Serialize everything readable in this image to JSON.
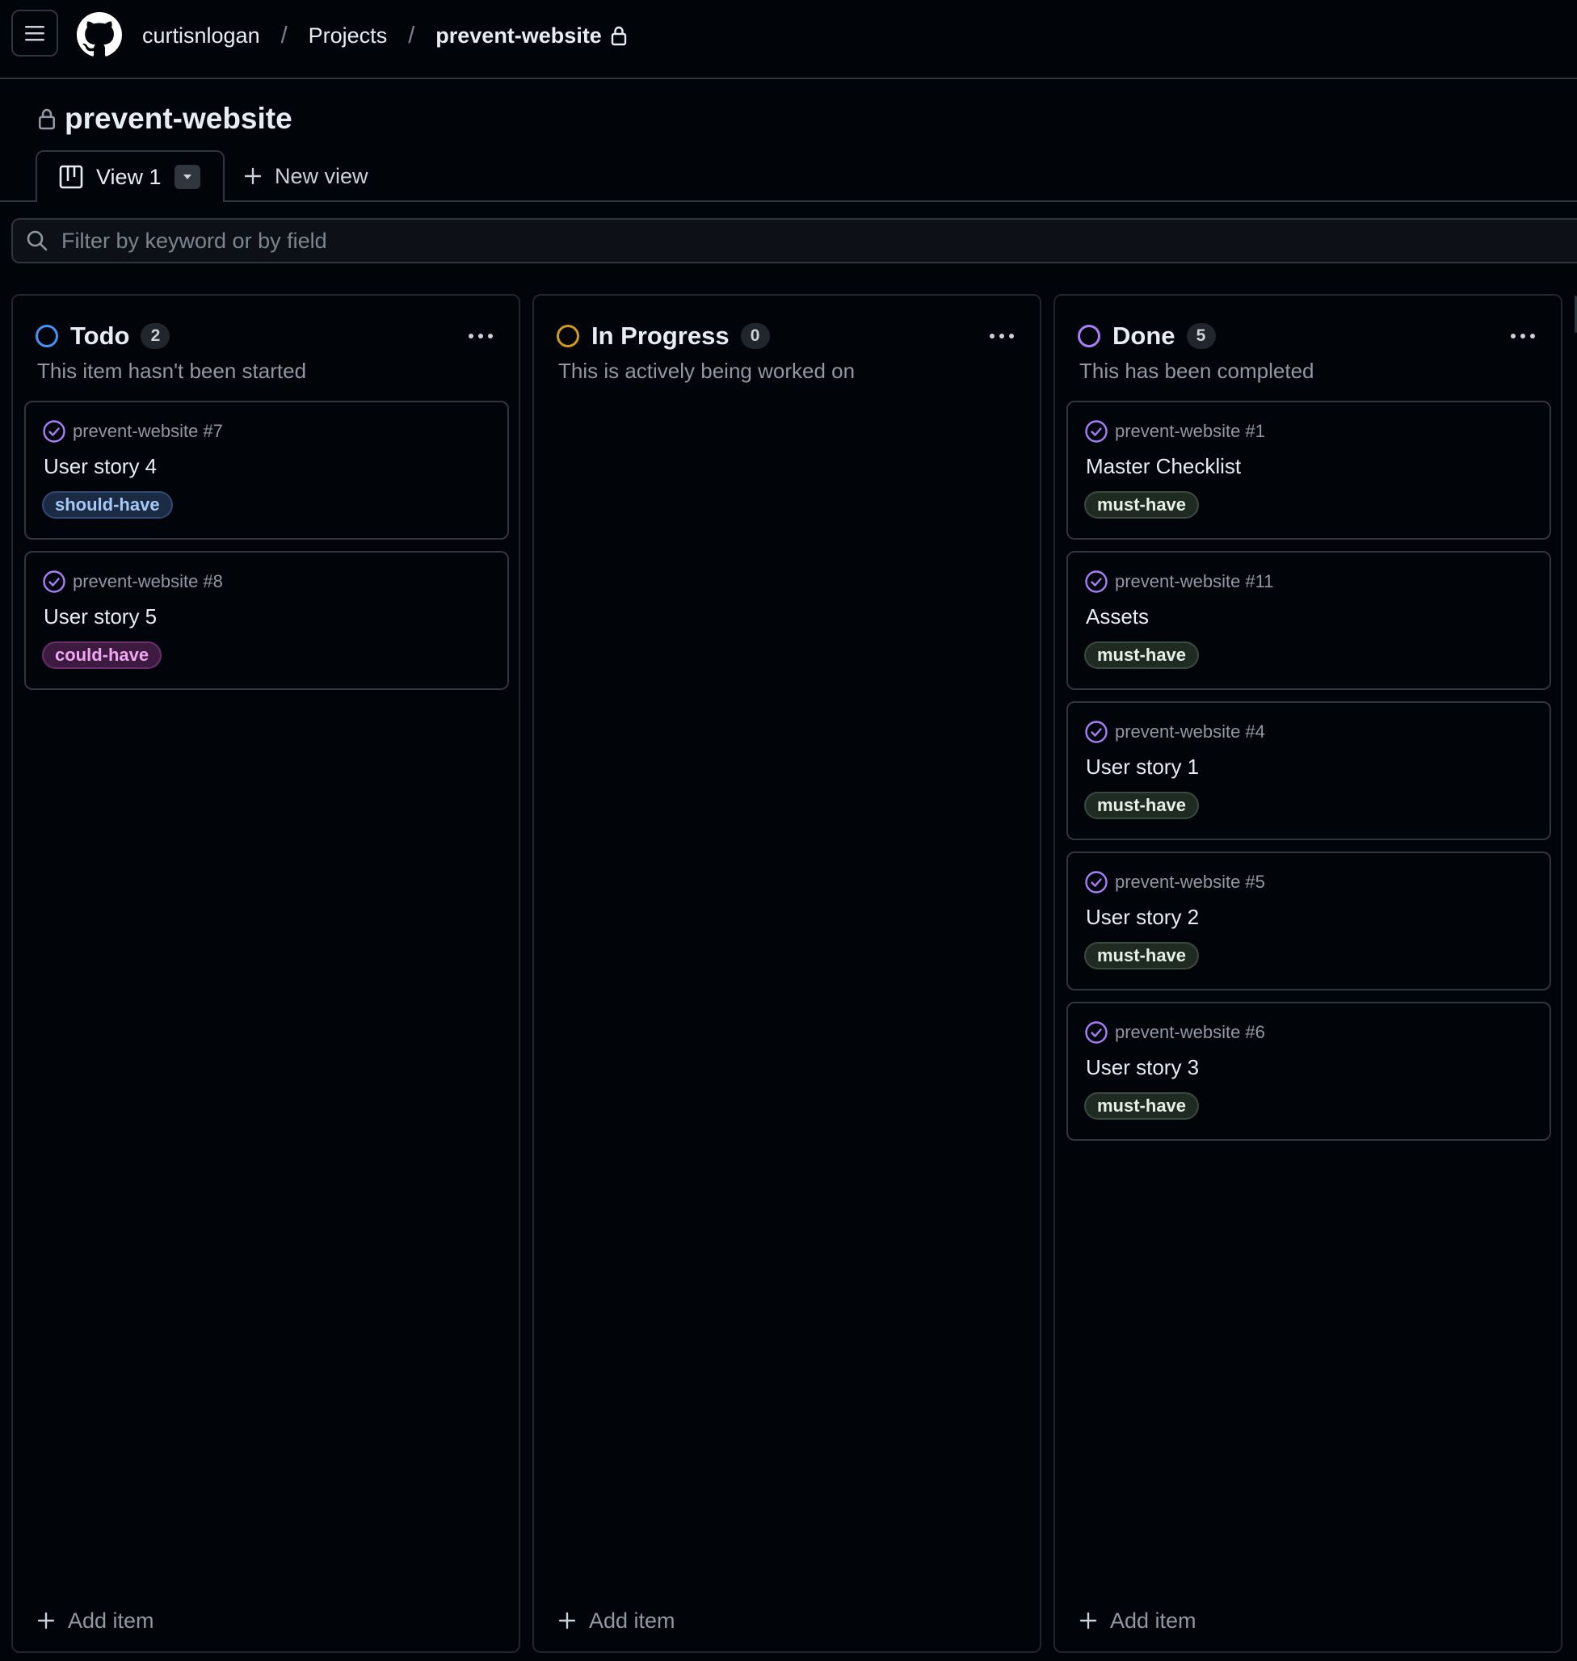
{
  "header": {
    "breadcrumbs": [
      "curtisnlogan",
      "Projects",
      "prevent-website"
    ],
    "separator": "/"
  },
  "project": {
    "title": "prevent-website"
  },
  "views": {
    "active_tab": "View 1",
    "new_view_label": "New view"
  },
  "filter": {
    "placeholder": "Filter by keyword or by field"
  },
  "columns": [
    {
      "name": "Todo",
      "count": "2",
      "color": "#4493f8",
      "description": "This item hasn't been started",
      "cards": [
        {
          "ref": "prevent-website #7",
          "title": "User story 4",
          "label": "should-have",
          "label_kind": "should"
        },
        {
          "ref": "prevent-website #8",
          "title": "User story 5",
          "label": "could-have",
          "label_kind": "could"
        }
      ],
      "add_label": "Add item"
    },
    {
      "name": "In Progress",
      "count": "0",
      "color": "#d29922",
      "description": "This is actively being worked on",
      "cards": [],
      "add_label": "Add item"
    },
    {
      "name": "Done",
      "count": "5",
      "color": "#ab7df8",
      "description": "This has been completed",
      "cards": [
        {
          "ref": "prevent-website #1",
          "title": "Master Checklist",
          "label": "must-have",
          "label_kind": "must"
        },
        {
          "ref": "prevent-website #11",
          "title": "Assets",
          "label": "must-have",
          "label_kind": "must"
        },
        {
          "ref": "prevent-website #4",
          "title": "User story 1",
          "label": "must-have",
          "label_kind": "must"
        },
        {
          "ref": "prevent-website #5",
          "title": "User story 2",
          "label": "must-have",
          "label_kind": "must"
        },
        {
          "ref": "prevent-website #6",
          "title": "User story 3",
          "label": "must-have",
          "label_kind": "must"
        }
      ],
      "add_label": "Add item"
    }
  ],
  "colors": {
    "background": "#010409",
    "border": "#30363d",
    "done_icon": "#ab7df8"
  },
  "icons": [
    "hamburger-icon",
    "github-logo",
    "lock-icon",
    "board-icon",
    "caret-down-icon",
    "plus-icon",
    "search-icon",
    "kebab-icon",
    "issue-closed-icon"
  ]
}
